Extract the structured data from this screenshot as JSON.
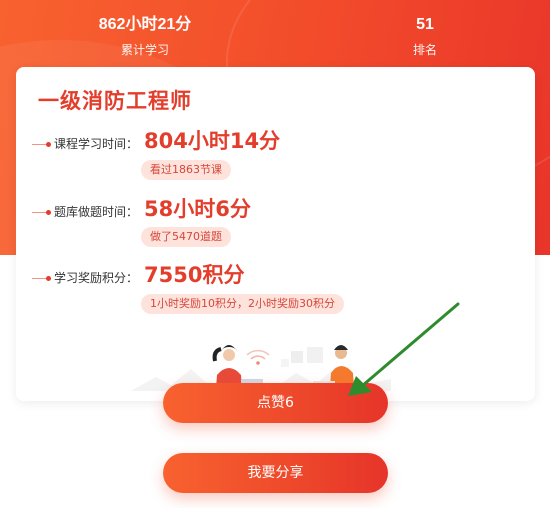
{
  "header": {
    "study_time": {
      "value": "862小时21分",
      "label": "累计学习"
    },
    "rank": {
      "value": "51",
      "label": "排名"
    }
  },
  "card": {
    "title": "一级消防工程师",
    "rows": [
      {
        "label": "课程学习时间：",
        "value": "804小时14分",
        "note": "看过1863节课"
      },
      {
        "label": "题库做题时间：",
        "value": "58小时6分",
        "note": "做了5470道题"
      },
      {
        "label": "学习奖励积分：",
        "value": "7550积分",
        "note": "1小时奖励10积分，2小时奖励30积分"
      }
    ]
  },
  "buttons": {
    "like_label": "点赞6",
    "share_label": "我要分享"
  },
  "colors": {
    "accent": "#e33d2c",
    "gradient_start": "#f8622f",
    "gradient_end": "#e6342a",
    "pill_bg": "#fde3dc",
    "annotation_arrow": "#2e8b2e"
  }
}
